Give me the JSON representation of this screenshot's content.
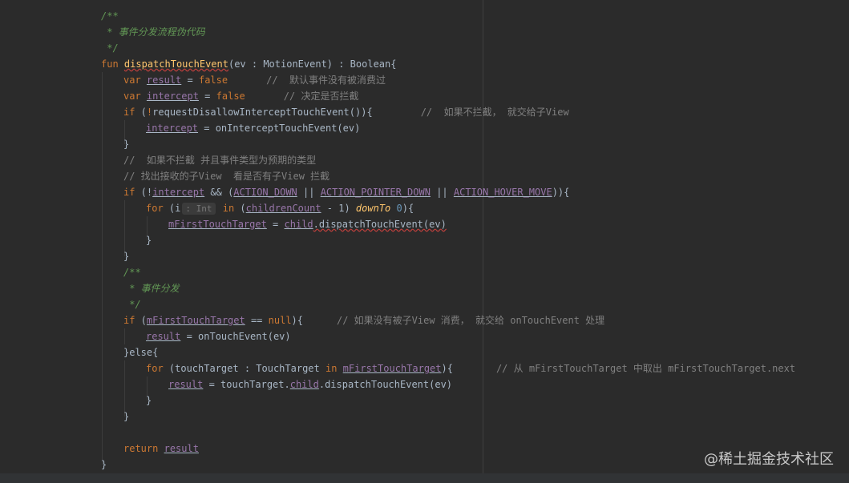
{
  "editor": {
    "doc_comment_open": "/**",
    "doc_comment_text": " * 事件分发流程伪代码",
    "doc_comment_close": " */",
    "fun_kw": "fun",
    "fun_name": "dispatchTouchEvent",
    "fun_params": "(ev : MotionEvent) : Boolean{",
    "var_kw": "var",
    "result_name": "result",
    "eq": " = ",
    "false_kw": "false",
    "comment_default": "//  默认事件没有被消费过",
    "intercept_name": "intercept",
    "comment_decide": "// 决定是否拦截",
    "if_kw": "if",
    "if1_open": " (",
    "not_op": "!",
    "req_call": "requestDisallowInterceptTouchEvent()){",
    "comment_if_not": "//  如果不拦截， 就交给子View",
    "assign_intercept_rhs": " = onInterceptTouchEvent(ev)",
    "close_brace": "}",
    "comment_line1": "//  如果不拦截 并且事件类型为预期的类型",
    "comment_line2": "// 找出接收的子View  看是否有子View 拦截",
    "if2_open": " (!",
    "and_op": " && (",
    "action_down": "ACTION_DOWN",
    "or_op": " || ",
    "action_pointer_down": "ACTION_POINTER_DOWN",
    "action_hover_move": "ACTION_HOVER_MOVE",
    "if2_close": ")){",
    "for_kw": "for",
    "for_open": " (i",
    "type_hint": ": Int",
    "in_kw": " in ",
    "paren_open": "(",
    "children_count": "childrenCount",
    "minus_one": " - 1) ",
    "down_to": "downTo",
    "zero": "0",
    "for_close": "){",
    "m_first": "mFirstTouchTarget",
    "child": "child",
    "dispatch_call": ".dispatchTouchEvent(ev)",
    "doc2_text": " * 事件分发",
    "eqeq": " == ",
    "null_kw": "null",
    "if3_close": "){",
    "comment_no_child": "// 如果没有被子View 消费， 就交给 onTouchEvent 处理",
    "assign_result_rhs": " = onTouchEvent(ev)",
    "else_line": "}else{",
    "for2_mid": " (touchTarget : TouchTarget ",
    "in2_kw": "in",
    "comment_from": "// 从 mFirstTouchTarget 中取出 mFirstTouchTarget.next",
    "touch_target_dot": " = touchTarget.",
    "return_kw": "return",
    "space": " "
  },
  "watermark": "@稀土掘金技术社区"
}
